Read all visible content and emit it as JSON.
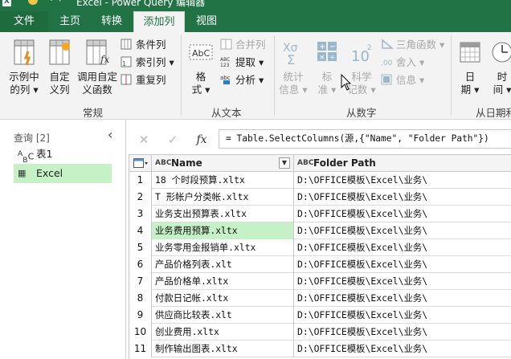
{
  "window": {
    "title": "Excel - Power Query 编辑器",
    "quick_access": "↩ ▾"
  },
  "tabs": [
    {
      "label": "文件"
    },
    {
      "label": "主页"
    },
    {
      "label": "转换"
    },
    {
      "label": "添加列"
    },
    {
      "label": "视图"
    }
  ],
  "ribbon": {
    "groups": {
      "general": "常规",
      "from_text": "从文本",
      "from_number": "从数字",
      "from_date": "从日期和"
    },
    "general": {
      "example_col": {
        "line1": "示例中",
        "line2": "的列 ▾"
      },
      "custom_col": {
        "line1": "自定",
        "line2": "义列"
      },
      "invoke_fn": {
        "line1": "调用自定",
        "line2": "义函数"
      },
      "conditional_col": "条件列",
      "index_col": "索引列 ▾",
      "duplicate_col": "重复列"
    },
    "from_text": {
      "format": {
        "line1": "格",
        "line2": "式 ▾"
      },
      "merge_cols": "合并列",
      "extract": "提取 ▾",
      "parse": "分析 ▾"
    },
    "from_number": {
      "statistics": {
        "line1": "统计",
        "line2": "信息 ▾"
      },
      "standard": {
        "line1": "标",
        "line2": "准 ▾"
      },
      "scientific": {
        "line1": "科学",
        "line2": "记数 ▾"
      },
      "trig": "三角函数 ▾",
      "rounding": "舍入 ▾",
      "information": "信息 ▾"
    },
    "from_date": {
      "date": {
        "line1": "日",
        "line2": "期 ▾"
      },
      "time": {
        "line1": "时",
        "line2": "间 ▾"
      }
    }
  },
  "queries_pane": {
    "header": "查询 [2]",
    "items": [
      {
        "icon": "A B C",
        "label": "表1"
      },
      {
        "icon": "▦",
        "label": "Excel"
      }
    ]
  },
  "formula_bar": {
    "cancel": "✕",
    "confirm": "✓",
    "fx": "fx",
    "formula": "= Table.SelectColumns(源,{\"Name\", \"Folder Path\"})"
  },
  "table": {
    "columns": [
      {
        "type_icon": "ABC",
        "name": "Name"
      },
      {
        "type_icon": "ABC",
        "name": "Folder Path"
      }
    ],
    "rows": [
      {
        "n": "1",
        "name": "18 个时段预算.xltx",
        "path": "D:\\OFFICE模板\\Excel\\业务\\"
      },
      {
        "n": "2",
        "name": "T 形帐户分类帐.xltx",
        "path": "D:\\OFFICE模板\\Excel\\业务\\"
      },
      {
        "n": "3",
        "name": "业务支出预算表.xltx",
        "path": "D:\\OFFICE模板\\Excel\\业务\\"
      },
      {
        "n": "4",
        "name": "业务费用预算.xltx",
        "path": "D:\\OFFICE模板\\Excel\\业务\\"
      },
      {
        "n": "5",
        "name": "业务零用金报销单.xltx",
        "path": "D:\\OFFICE模板\\Excel\\业务\\"
      },
      {
        "n": "6",
        "name": "产品价格列表.xlt",
        "path": "D:\\OFFICE模板\\Excel\\业务\\"
      },
      {
        "n": "7",
        "name": "产品价格单.xltx",
        "path": "D:\\OFFICE模板\\Excel\\业务\\"
      },
      {
        "n": "8",
        "name": "付款日记帐.xltx",
        "path": "D:\\OFFICE模板\\Excel\\业务\\"
      },
      {
        "n": "9",
        "name": "供应商比较表.xlt",
        "path": "D:\\OFFICE模板\\Excel\\业务\\"
      },
      {
        "n": "10",
        "name": "创业费用.xltx",
        "path": "D:\\OFFICE模板\\Excel\\业务\\"
      },
      {
        "n": "11",
        "name": "制作输出图表.xltx",
        "path": "D:\\OFFICE模板\\Excel\\业务\\"
      }
    ],
    "selected_row": 4
  },
  "colors": {
    "accent": "#217346",
    "selection": "#c6f0c6"
  }
}
